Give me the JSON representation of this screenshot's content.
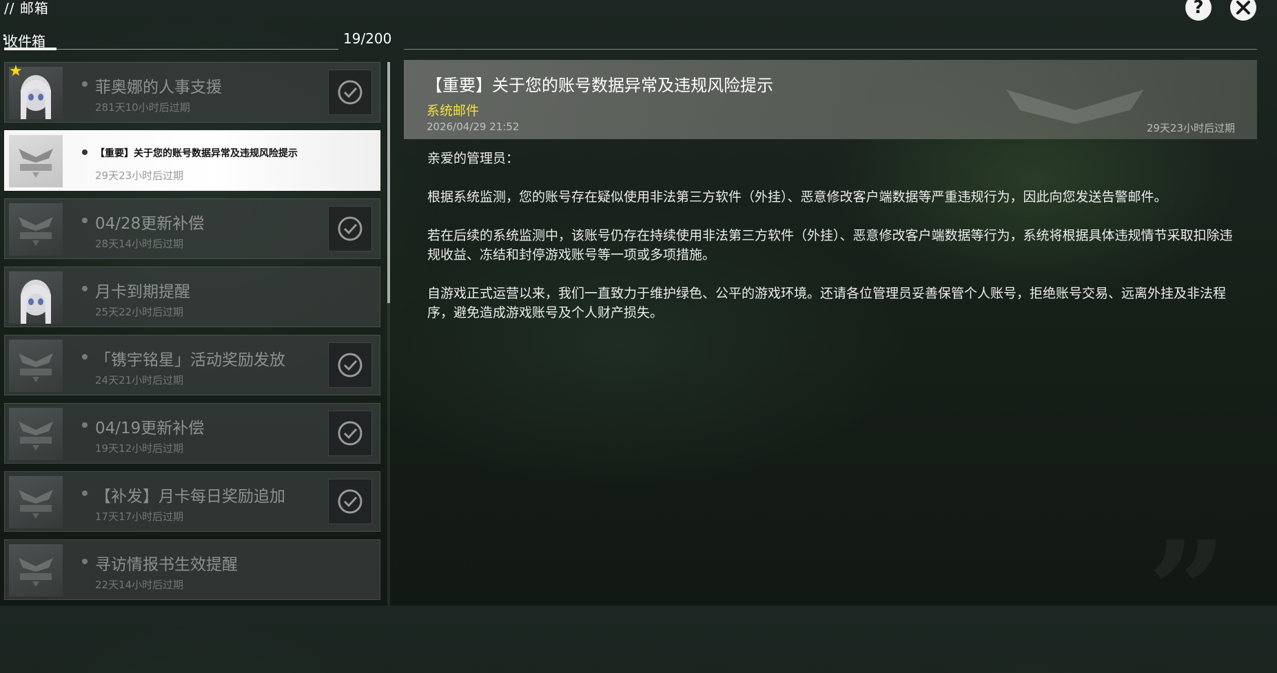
{
  "header": {
    "title": "// 邮箱",
    "help_icon": "help-icon",
    "close_icon": "close-icon"
  },
  "inbox": {
    "label": "收件箱",
    "count": "19/200",
    "items": [
      {
        "title": "菲奥娜的人事支援",
        "expire": "281天10小时后过期",
        "thumb": "avatar",
        "starred": true,
        "claimed": true
      },
      {
        "title": "【重要】关于您的账号数据异常及违规风险提示",
        "expire": "29天23小时后过期",
        "thumb": "logo",
        "selected": true,
        "claimed": false
      },
      {
        "title": "04/28更新补偿",
        "expire": "28天14小时后过期",
        "thumb": "logo",
        "claimed": true
      },
      {
        "title": "月卡到期提醒",
        "expire": "25天22小时后过期",
        "thumb": "avatar",
        "claimed": false
      },
      {
        "title": "「镌宇铭星」活动奖励发放",
        "expire": "24天21小时后过期",
        "thumb": "logo",
        "claimed": true
      },
      {
        "title": "04/19更新补偿",
        "expire": "19天12小时后过期",
        "thumb": "logo",
        "claimed": true
      },
      {
        "title": "【补发】月卡每日奖励追加",
        "expire": "17天17小时后过期",
        "thumb": "logo",
        "claimed": true
      },
      {
        "title": "寻访情报书生效提醒",
        "expire": "22天14小时后过期",
        "thumb": "logo",
        "claimed": false
      }
    ]
  },
  "detail": {
    "title": "【重要】关于您的账号数据异常及违规风险提示",
    "sender": "系统邮件",
    "date": "2026/04/29 21:52",
    "expire": "29天23小时后过期",
    "body": [
      "亲爱的管理员：",
      "根据系统监测，您的账号存在疑似使用非法第三方软件（外挂）、恶意修改客户端数据等严重违规行为，因此向您发送告警邮件。",
      "若在后续的系统监测中，该账号仍存在持续使用非法第三方软件（外挂）、恶意修改客户端数据等行为，系统将根据具体违规情节采取扣除违规收益、冻结和封停游戏账号等一项或多项措施。",
      "自游戏正式运营以来，我们一直致力于维护绿色、公平的游戏环境。还请各位管理员妥善保管个人账号，拒绝账号交易、远离外挂及非法程序，避免造成游戏账号及个人财产损失。"
    ]
  },
  "colors": {
    "sender": "#f5e33a",
    "star": "#ffd81a",
    "selected_bg": "#ffffff"
  }
}
